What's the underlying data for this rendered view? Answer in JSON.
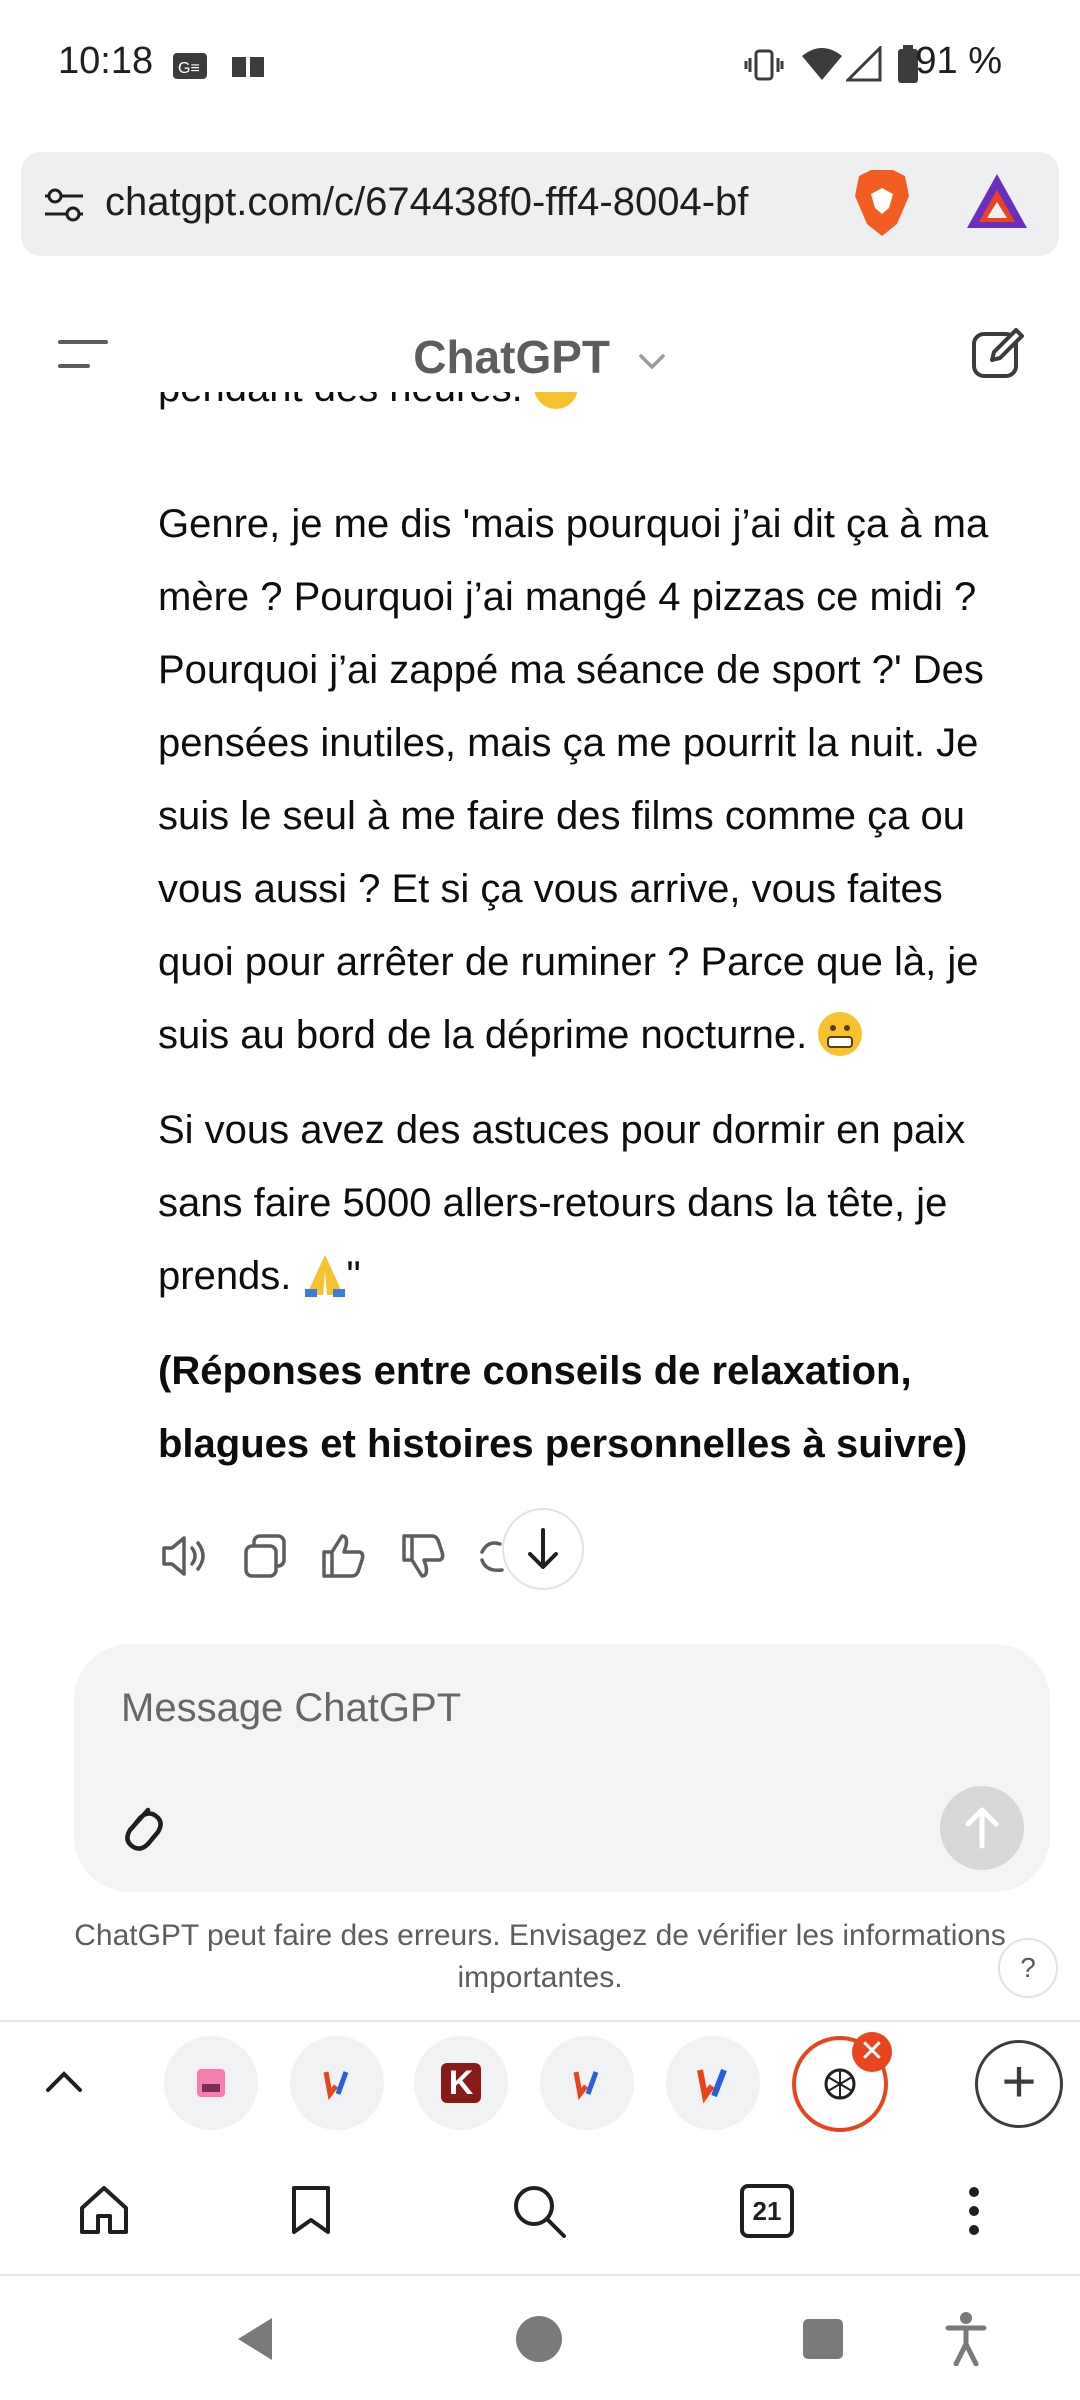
{
  "status_bar": {
    "time": "10:18",
    "battery": "91 %"
  },
  "browser": {
    "url": "chatgpt.com/c/674438f0-fff4-8004-bf",
    "tab_count": "21"
  },
  "header": {
    "title": "ChatGPT"
  },
  "message": {
    "partial_line": "pendant des heures.",
    "paragraph_1_lines": [
      "Genre, je me dis 'mais pourquoi j’ai dit ça à ma",
      "mère ? Pourquoi j’ai mangé 4 pizzas ce midi ?",
      "Pourquoi j’ai zappé ma séance de sport ?' Des",
      "pensées inutiles, mais ça me pourrit la nuit. Je",
      "suis le seul à me faire des films comme ça ou",
      "vous aussi ? Et si ça vous arrive, vous faites",
      "quoi pour arrêter de ruminer ? Parce que là, je",
      "suis au bord de la déprime nocturne."
    ],
    "paragraph_2_lines": [
      "Si vous avez des astuces pour dormir en paix",
      "sans faire 5000 allers-retours dans la tête, je",
      "prends."
    ],
    "paragraph_2_end_quote": "\"",
    "bold_lines": [
      "(Réponses entre conseils de relaxation,",
      "blagues et histoires personnelles à suivre)"
    ]
  },
  "composer": {
    "placeholder": "Message ChatGPT"
  },
  "disclaimer": "ChatGPT peut faire des erreurs. Envisagez de vérifier les informations importantes.",
  "help_label": "?",
  "tabs": [
    {
      "icon": "pink-app-icon"
    },
    {
      "icon": "jv-icon"
    },
    {
      "icon": "k-icon",
      "label": "K"
    },
    {
      "icon": "jv-icon"
    },
    {
      "icon": "jv-icon"
    },
    {
      "icon": "chatgpt-icon",
      "active": true
    }
  ],
  "colors": {
    "accent": "#e8451f",
    "text": "#0d0d0d",
    "muted": "#5d5d5d"
  }
}
